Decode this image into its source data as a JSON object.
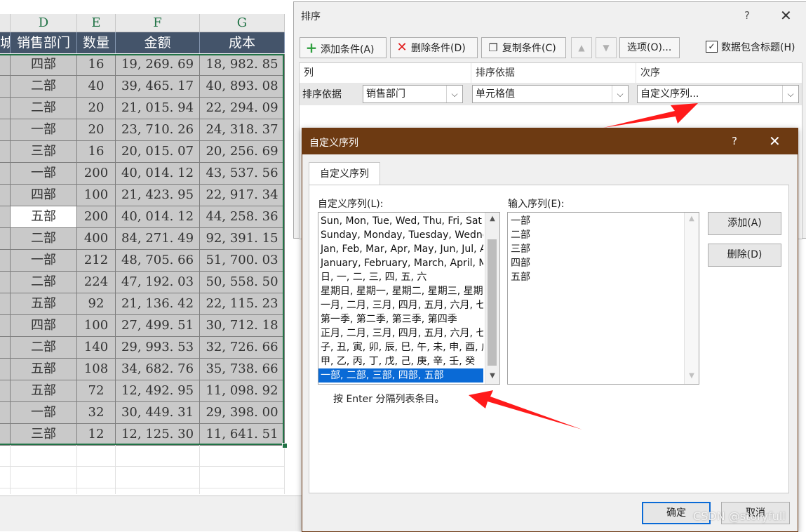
{
  "sheet": {
    "columns": [
      "D",
      "E",
      "F",
      "G"
    ],
    "header_partial": "城",
    "headers": [
      "销售部门",
      "数量",
      "金额",
      "成本"
    ],
    "rows": [
      [
        "四部",
        "16",
        "19, 269. 69",
        "18, 982. 85"
      ],
      [
        "二部",
        "40",
        "39, 465. 17",
        "40, 893. 08"
      ],
      [
        "二部",
        "20",
        "21, 015. 94",
        "22, 294. 09"
      ],
      [
        "一部",
        "20",
        "23, 710. 26",
        "24, 318. 37"
      ],
      [
        "三部",
        "16",
        "20, 015. 07",
        "20, 256. 69"
      ],
      [
        "一部",
        "200",
        "40, 014. 12",
        "43, 537. 56"
      ],
      [
        "四部",
        "100",
        "21, 423. 95",
        "22, 917. 34"
      ],
      [
        "五部",
        "200",
        "40, 014. 12",
        "44, 258. 36"
      ],
      [
        "二部",
        "400",
        "84, 271. 49",
        "92, 391. 15"
      ],
      [
        "一部",
        "212",
        "48, 705. 66",
        "51, 700. 03"
      ],
      [
        "二部",
        "224",
        "47, 192. 03",
        "50, 558. 50"
      ],
      [
        "五部",
        "92",
        "21, 136. 42",
        "22, 115. 23"
      ],
      [
        "四部",
        "100",
        "27, 499. 51",
        "30, 712. 18"
      ],
      [
        "二部",
        "140",
        "29, 993. 53",
        "32, 726. 66"
      ],
      [
        "五部",
        "108",
        "34, 682. 76",
        "35, 738. 66"
      ],
      [
        "五部",
        "72",
        "12, 492. 95",
        "11, 098. 92"
      ],
      [
        "一部",
        "32",
        "30, 449. 31",
        "29, 398. 00"
      ],
      [
        "三部",
        "12",
        "12, 125. 30",
        "11, 641. 51"
      ]
    ]
  },
  "sort_dialog": {
    "title": "排序",
    "help": "?",
    "close": "✕",
    "add_condition": "添加条件(A)",
    "delete_condition": "删除条件(D)",
    "copy_condition": "复制条件(C)",
    "move_up": "▲",
    "move_down": "▼",
    "options": "选项(O)...",
    "has_header_label": "数据包含标题(H)",
    "has_header_checked": "✓",
    "col_header": "列",
    "sort_on_header": "排序依据",
    "order_header": "次序",
    "row_label": "排序依据",
    "column_value": "销售部门",
    "sort_on_value": "单元格值",
    "order_value": "自定义序列..."
  },
  "custom_list_dialog": {
    "title": "自定义序列",
    "help": "?",
    "close": "✕",
    "tab": "自定义序列",
    "lists_label": "自定义序列(L):",
    "entries_label": "输入序列(E):",
    "lists": [
      "Sun, Mon, Tue, Wed, Thu, Fri, Sat",
      "Sunday, Monday, Tuesday, Wednesday",
      "Jan, Feb, Mar, Apr, May, Jun, Jul, Aug",
      "January, February, March, April, May",
      "日, 一, 二, 三, 四, 五, 六",
      "星期日, 星期一, 星期二, 星期三, 星期四",
      "一月, 二月, 三月, 四月, 五月, 六月, 七月",
      "第一季, 第二季, 第三季, 第四季",
      "正月, 二月, 三月, 四月, 五月, 六月, 七月",
      "子, 丑, 寅, 卯, 辰, 巳, 午, 未, 申, 酉, 戌",
      "甲, 乙, 丙, 丁, 戊, 己, 庚, 辛, 壬, 癸",
      "一部, 二部, 三部, 四部, 五部"
    ],
    "selected_index": 11,
    "entries": [
      "一部",
      "二部",
      "三部",
      "四部",
      "五部"
    ],
    "add_button": "添加(A)",
    "delete_button": "删除(D)",
    "hint": "按 Enter 分隔列表条目。",
    "ok_button": "确定",
    "cancel_button": "取消"
  },
  "watermark": "CSDN @storyfull",
  "colors": {
    "header_bg": "#44546a",
    "cell_bg": "#c9c9c9",
    "selection": "#217346",
    "dialog_title_bg": "#6d3a12",
    "list_selection": "#0a6ad6",
    "annotation_arrow": "#ff1a1a"
  }
}
